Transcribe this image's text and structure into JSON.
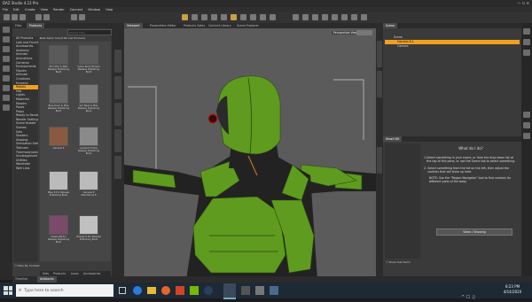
{
  "window": {
    "title": "DAZ Studio 4.12 Pro"
  },
  "menu": [
    "File",
    "Edit",
    "Create",
    "View",
    "Render",
    "Connect",
    "Window",
    "Help"
  ],
  "content_library": {
    "tabs": [
      "Files",
      "Products"
    ],
    "search_placeholder": "Search Files",
    "breadcrumb": "Best Seller Smart Rb Cat Products",
    "categories": [
      "All Products",
      "Lost and Found",
      "Accessories",
      "Anatomy",
      "Animals",
      "Animations",
      "Cameras",
      "Environments",
      "Figures",
      "Animals",
      "Creatures",
      "Humans",
      "Robots",
      "Hair",
      "Lights",
      "Materials",
      "Morphs",
      "Poses",
      "Props",
      "Ready to Render",
      "Render Settings",
      "Scene Builder",
      "Scenes",
      "Sets",
      "Shaders",
      "Shaping",
      "Simulation Sets",
      "Textures",
      "Thermodynamics",
      "Uncategorized",
      "Utilities",
      "Wardrobe",
      "Well Lists"
    ],
    "selected_category_index": 12,
    "filter_label": "Filter By Context",
    "bottom_tabs": [
      "Sets",
      "Products",
      "Icons",
      "Accessories"
    ],
    "thumbnails": [
      {
        "label": "Bird Man & Miss Release Publishing Build"
      },
      {
        "label": "Cyber Body Morphs Release Publishing Build"
      },
      {
        "label": "Blue Diver & Miss Release Publishing Build"
      },
      {
        "label": "Girl Base & Miss Release Publishing Build"
      },
      {
        "label": "Genesis 8"
      },
      {
        "label": "Lambert 8 Miss Release Publishing Build"
      },
      {
        "label": "Male 8 Pro Release Publishing Build"
      },
      {
        "label": "Genesis 8 Standalone 8"
      },
      {
        "label": "Cassie 8B Pro Release Publishing Build"
      },
      {
        "label": "Bridget 8 Pro Release Publishing Build"
      }
    ]
  },
  "viewport": {
    "tabs": [
      "Viewport",
      "Parameters Editor",
      "Products Sales",
      "Content Library",
      "Scene Explorer"
    ],
    "view_label": "Perspective View"
  },
  "scene": {
    "header": "Scene",
    "items": [
      {
        "label": "Scene",
        "selected": false
      },
      {
        "label": "Genesis 8.1",
        "selected": true
      },
      {
        "label": "Camera",
        "selected": false
      }
    ]
  },
  "tips": {
    "tab": "Smart Kit",
    "title": "What do I do?",
    "steps": [
      "Select something in your scene, or from the drop down list at the top of this pane, or use the Scene tab to select something.",
      "Select something from the list on the left, then adjust the controls that will show up here."
    ],
    "note": "NOTE: Use the \"Region Navigator\" tool to find controls for different parts of the body.",
    "video_button": "Video / Showing",
    "show_hidden": "Show Sub Items"
  },
  "bottom_tabs": [
    "Timeline",
    "Aniblocks"
  ],
  "taskbar": {
    "search_placeholder": "Type here to search",
    "time": "8:23 PM",
    "date": "4/14/2020"
  },
  "colors": {
    "accent": "#f0a020",
    "robot_green": "#5f9b1f",
    "viewport_bg": "#5b5b5b"
  }
}
